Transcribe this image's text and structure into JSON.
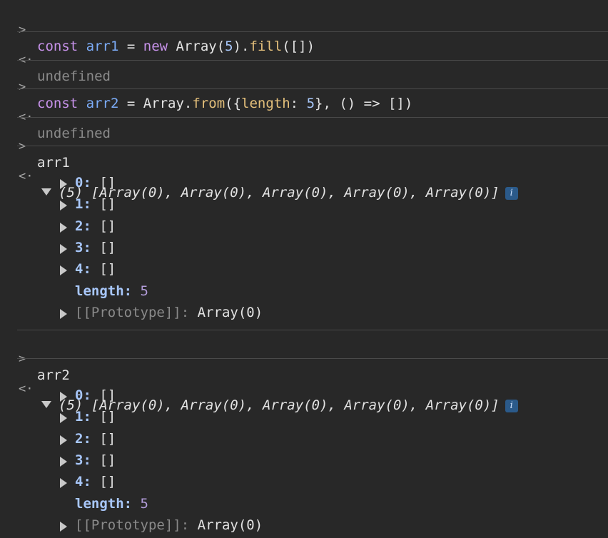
{
  "entries": [
    {
      "input": {
        "kw": "const",
        "name": "arr1",
        "eq": " = ",
        "kw2": "new",
        "rest1": " Array(",
        "num": "5",
        "rest2": ").",
        "fn": "fill",
        "rest3": "([])"
      }
    },
    {
      "result": "undefined"
    },
    {
      "input2": {
        "kw": "const",
        "name": "arr2",
        "eq": " = Array.",
        "fn": "from",
        "rest1": "({",
        "key": "length",
        "rest2": ": ",
        "num": "5",
        "rest3": "}, () => [])"
      }
    },
    {
      "result": "undefined"
    }
  ],
  "prompts": {
    "input": ">",
    "output": "<·"
  },
  "blocks": [
    {
      "command": "arr1",
      "summary": "(5) [Array(0), Array(0), Array(0), Array(0), Array(0)]",
      "info_label": "i",
      "items": [
        {
          "key": "0",
          "value": "[]"
        },
        {
          "key": "1",
          "value": "[]"
        },
        {
          "key": "2",
          "value": "[]"
        },
        {
          "key": "3",
          "value": "[]"
        },
        {
          "key": "4",
          "value": "[]"
        }
      ],
      "length_key": "length",
      "length_value": "5",
      "proto_key": "[[Prototype]]",
      "proto_value": "Array(0)"
    },
    {
      "command": "arr2",
      "summary": "(5) [Array(0), Array(0), Array(0), Array(0), Array(0)]",
      "info_label": "i",
      "items": [
        {
          "key": "0",
          "value": "[]"
        },
        {
          "key": "1",
          "value": "[]"
        },
        {
          "key": "2",
          "value": "[]"
        },
        {
          "key": "3",
          "value": "[]"
        },
        {
          "key": "4",
          "value": "[]"
        }
      ],
      "length_key": "length",
      "length_value": "5",
      "proto_key": "[[Prototype]]",
      "proto_value": "Array(0)"
    }
  ],
  "colors": {
    "background": "#282828",
    "keyword": "#c792ea",
    "variable": "#7cacf8",
    "function": "#e5c07b",
    "number": "#a8c7fa",
    "muted": "#8a8a8a",
    "length_value": "#b39ddb"
  }
}
